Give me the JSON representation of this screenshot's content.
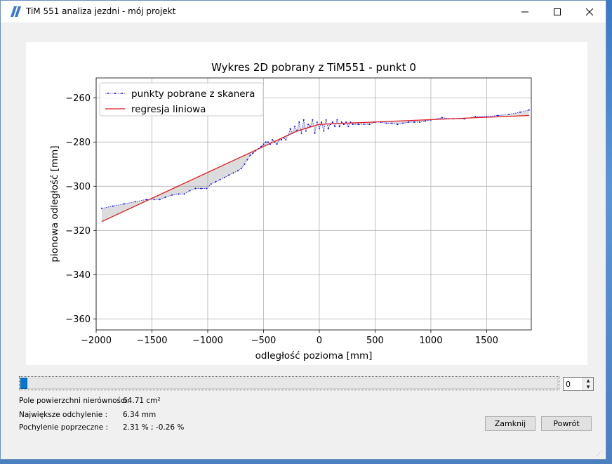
{
  "window": {
    "title": "TiM 551 analiza jezdni - mój projekt",
    "minimize_label": "—",
    "maximize_label": "☐",
    "close_label": "✕"
  },
  "chart_data": {
    "type": "line",
    "title": "Wykres 2D pobrany z TiM551 - punkt 0",
    "xlabel": "odległość pozioma [mm]",
    "ylabel": "pionowa odległość [mm]",
    "xlim": [
      -2000,
      1900
    ],
    "ylim": [
      -365,
      -251
    ],
    "xticks": [
      -2000,
      -1500,
      -1000,
      -500,
      0,
      500,
      1000,
      1500
    ],
    "yticks": [
      -260,
      -280,
      -300,
      -320,
      -340,
      -360
    ],
    "xtick_labels": [
      "−2000",
      "−1500",
      "−1000",
      "−500",
      "0",
      "500",
      "1000",
      "1500"
    ],
    "ytick_labels": [
      "−260",
      "−280",
      "−300",
      "−320",
      "−340",
      "−360"
    ],
    "grid": true,
    "legend_position": "top-left",
    "series": [
      {
        "name": "punkty pobrane z skanera",
        "style": "dotted-markers",
        "color": "#0000ff",
        "x": [
          -1950,
          -1850,
          -1750,
          -1650,
          -1550,
          -1480,
          -1430,
          -1380,
          -1320,
          -1260,
          -1210,
          -1160,
          -1110,
          -1060,
          -1010,
          -970,
          -930,
          -890,
          -850,
          -810,
          -770,
          -730,
          -700,
          -670,
          -645,
          -620,
          -595,
          -570,
          -545,
          -520,
          -500,
          -480,
          -460,
          -440,
          -420,
          -400,
          -380,
          -360,
          -340,
          -320,
          -300,
          -280,
          -260,
          -240,
          -220,
          -200,
          -180,
          -160,
          -140,
          -120,
          -100,
          -80,
          -60,
          -40,
          -20,
          0,
          20,
          40,
          60,
          80,
          100,
          120,
          140,
          160,
          180,
          200,
          220,
          240,
          260,
          280,
          300,
          350,
          400,
          450,
          500,
          550,
          600,
          650,
          700,
          750,
          800,
          850,
          900,
          950,
          1000,
          1100,
          1200,
          1300,
          1400,
          1500,
          1600,
          1700,
          1800,
          1880
        ],
        "y": [
          -310,
          -309,
          -308,
          -307,
          -306,
          -306,
          -306,
          -305,
          -304,
          -303.5,
          -303.5,
          -302,
          -301,
          -301,
          -301,
          -299,
          -298,
          -297,
          -296,
          -295,
          -294,
          -293,
          -292,
          -290,
          -288,
          -286,
          -285,
          -284,
          -283,
          -282,
          -281,
          -280,
          -280,
          -281,
          -279,
          -280,
          -281,
          -279,
          -279,
          -278,
          -279,
          -277,
          -274,
          -276,
          -273,
          -275,
          -271,
          -276,
          -270,
          -275,
          -272,
          -273,
          -270,
          -276,
          -271,
          -274,
          -271,
          -275,
          -270,
          -274,
          -272,
          -271,
          -273,
          -270,
          -273,
          -271,
          -272,
          -271,
          -273,
          -271,
          -272,
          -272,
          -272,
          -272,
          -271,
          -271,
          -271.5,
          -271.5,
          -272,
          -271.5,
          -271,
          -271,
          -271,
          -270.5,
          -270,
          -269,
          -269.5,
          -269.5,
          -268.5,
          -268.5,
          -268,
          -267.5,
          -266.5,
          -265.5
        ]
      },
      {
        "name": "regresja liniowa",
        "style": "line",
        "color": "#e31a1c",
        "x": [
          -1950,
          -200,
          0,
          1880
        ],
        "y": [
          -316,
          -275,
          -272,
          -268
        ]
      }
    ]
  },
  "slider": {
    "value": 0,
    "min": 0
  },
  "spinbox": {
    "value": "0",
    "up_glyph": "▲",
    "down_glyph": "▼"
  },
  "info": {
    "area_label": "Pole powierzchni nierówności:",
    "area_value": "64.71 cm²",
    "deviation_label": "Największe odchylenie :",
    "deviation_value": "6.34 mm",
    "slope_label": "Pochylenie poprzeczne :",
    "slope_value": "2.31 % ; -0.26 %"
  },
  "buttons": {
    "close_label": "Zamknij",
    "back_label": "Powrót"
  },
  "grip": "⋰",
  "colors": {
    "accent": "#0078d7",
    "title_bg": "#ffffff",
    "window_bg": "#f0f0f0"
  }
}
